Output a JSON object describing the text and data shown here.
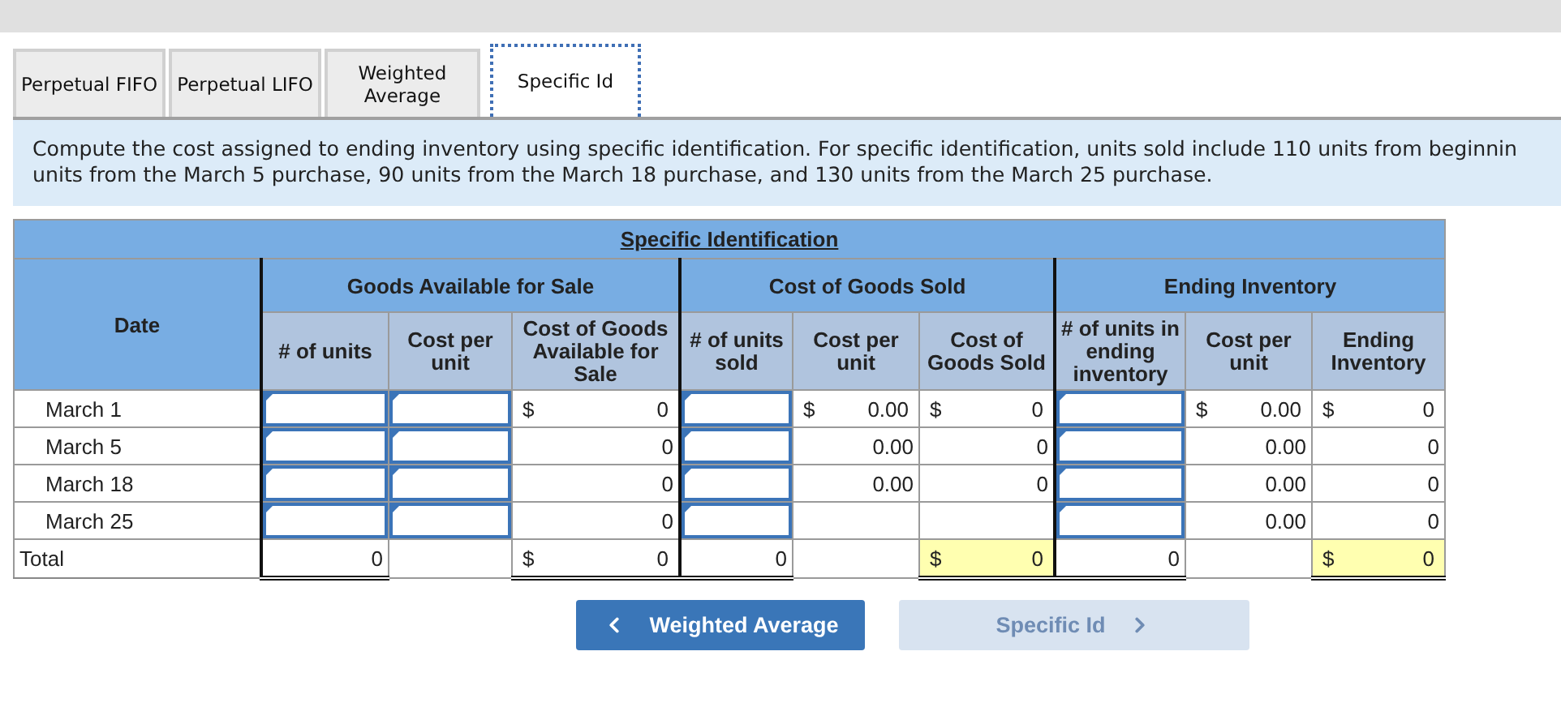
{
  "tabs": [
    {
      "label": "Perpetual FIFO",
      "selected": false
    },
    {
      "label": "Perpetual LIFO",
      "selected": false
    },
    {
      "label": "Weighted Average",
      "selected": false
    },
    {
      "label": "Specific Id",
      "selected": true
    }
  ],
  "instructions": [
    "Compute the cost assigned to ending inventory using specific identification. For specific identification, units sold include 110 units from beginnin",
    "units from the March 5 purchase, 90 units from the March 18 purchase, and 130 units from the March 25 purchase."
  ],
  "table": {
    "title": "Specific Identification",
    "date_header": "Date",
    "groups": [
      {
        "label": "Goods Available for Sale",
        "columns": [
          "# of units",
          "Cost per unit",
          "Cost of Goods Available for Sale"
        ]
      },
      {
        "label": "Cost of Goods Sold",
        "columns": [
          "# of units sold",
          "Cost per unit",
          "Cost of Goods Sold"
        ]
      },
      {
        "label": "Ending Inventory",
        "columns": [
          "# of units in ending inventory",
          "Cost per unit",
          "Ending Inventory"
        ]
      }
    ],
    "rows": [
      {
        "kind": "entry",
        "date": "March 1",
        "cells": [
          {
            "kind": "input"
          },
          {
            "kind": "input"
          },
          {
            "kind": "money",
            "currency": "$",
            "value": "0"
          },
          {
            "kind": "input"
          },
          {
            "kind": "money",
            "currency": "$",
            "value": "0.00"
          },
          {
            "kind": "money",
            "currency": "$",
            "value": "0"
          },
          {
            "kind": "input"
          },
          {
            "kind": "money",
            "currency": "$",
            "value": "0.00"
          },
          {
            "kind": "money",
            "currency": "$",
            "value": "0"
          }
        ]
      },
      {
        "kind": "entry",
        "date": "March 5",
        "cells": [
          {
            "kind": "input"
          },
          {
            "kind": "input"
          },
          {
            "kind": "text",
            "value": "0"
          },
          {
            "kind": "input"
          },
          {
            "kind": "text",
            "value": "0.00"
          },
          {
            "kind": "text",
            "value": "0"
          },
          {
            "kind": "input"
          },
          {
            "kind": "text",
            "value": "0.00"
          },
          {
            "kind": "text",
            "value": "0"
          }
        ]
      },
      {
        "kind": "entry",
        "date": "March 18",
        "cells": [
          {
            "kind": "input"
          },
          {
            "kind": "input"
          },
          {
            "kind": "text",
            "value": "0"
          },
          {
            "kind": "input"
          },
          {
            "kind": "text",
            "value": "0.00"
          },
          {
            "kind": "text",
            "value": "0"
          },
          {
            "kind": "input"
          },
          {
            "kind": "text",
            "value": "0.00"
          },
          {
            "kind": "text",
            "value": "0"
          }
        ]
      },
      {
        "kind": "entry",
        "date": "March 25",
        "cells": [
          {
            "kind": "input"
          },
          {
            "kind": "input"
          },
          {
            "kind": "text",
            "value": "0"
          },
          {
            "kind": "input"
          },
          {
            "kind": "empty"
          },
          {
            "kind": "empty"
          },
          {
            "kind": "input"
          },
          {
            "kind": "text",
            "value": "0.00"
          },
          {
            "kind": "text",
            "value": "0"
          }
        ]
      },
      {
        "kind": "total",
        "date": "Total",
        "cells": [
          {
            "kind": "text",
            "value": "0",
            "highlighted": false
          },
          {
            "kind": "empty",
            "highlighted": false
          },
          {
            "kind": "money",
            "currency": "$",
            "value": "0",
            "highlighted": false
          },
          {
            "kind": "text",
            "value": "0",
            "highlighted": false
          },
          {
            "kind": "empty",
            "highlighted": false
          },
          {
            "kind": "money",
            "currency": "$",
            "value": "0",
            "highlighted": true
          },
          {
            "kind": "text",
            "value": "0",
            "highlighted": false
          },
          {
            "kind": "empty",
            "highlighted": false
          },
          {
            "kind": "money",
            "currency": "$",
            "value": "0",
            "highlighted": true
          }
        ]
      }
    ]
  },
  "nav": [
    {
      "kind": "previous",
      "label": "Weighted Average",
      "disabled": false
    },
    {
      "kind": "next",
      "label": "Specific Id",
      "disabled": true
    }
  ]
}
